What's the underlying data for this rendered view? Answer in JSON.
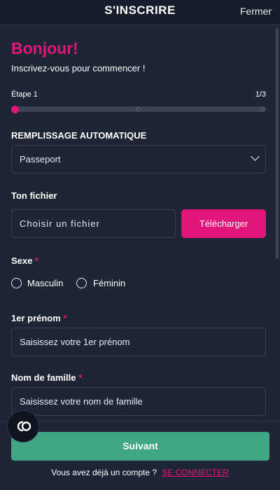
{
  "header": {
    "title": "S'INSCRIRE",
    "close_label": "Fermer"
  },
  "intro": {
    "greeting": "Bonjour!",
    "subtitle": "Inscrivez-vous pour commencer !"
  },
  "progress": {
    "step_label": "Étape 1",
    "step_count": "1/3",
    "value": 0.0
  },
  "autofill": {
    "label": "REMPLISSAGE AUTOMATIQUE",
    "selected": "Passeport"
  },
  "file": {
    "label": "Ton fichier",
    "placeholder": "Choisir un fichier",
    "upload_label": "Télécharger"
  },
  "sex": {
    "label": "Sexe",
    "required_mark": "*",
    "options": [
      "Masculin",
      "Féminin"
    ]
  },
  "first_name": {
    "label": "1er prénom",
    "required_mark": "*",
    "placeholder": "Saisissez votre 1er prénom"
  },
  "last_name": {
    "label": "Nom de famille",
    "required_mark": "*",
    "placeholder": "Saisissez votre nom de famille"
  },
  "footer": {
    "next_label": "Suivant",
    "account_question": "Vous avez déjà un compte ?",
    "login_link": "SE CONNECTER"
  },
  "colors": {
    "accent": "#e2157a",
    "primary_button": "#3fa684",
    "background": "#1e2535"
  },
  "icons": {
    "chat": "chat-bubble-icon",
    "chevron": "chevron-down-icon"
  }
}
